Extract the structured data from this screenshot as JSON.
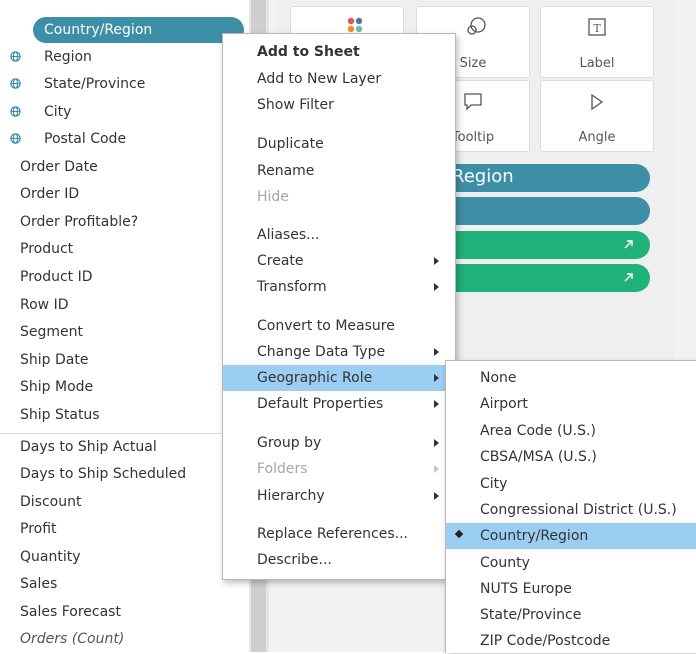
{
  "data_pane": {
    "geo_fields": [
      {
        "label": "Country/Region",
        "selected": true
      },
      {
        "label": "Region"
      },
      {
        "label": "State/Province"
      },
      {
        "label": "City"
      },
      {
        "label": "Postal Code"
      }
    ],
    "dimensions": [
      "Order Date",
      "Order ID",
      "Order Profitable?",
      "Product",
      "Product ID",
      "Row ID",
      "Segment",
      "Ship Date",
      "Ship Mode",
      "Ship Status"
    ],
    "measures": [
      "Days to Ship Actual",
      "Days to Ship Scheduled",
      "Discount",
      "Profit",
      "Quantity",
      "Sales",
      "Sales Forecast"
    ],
    "count_field": "Orders (Count)"
  },
  "marks_card": {
    "buttons": [
      {
        "label": "Size",
        "icon": "size-icon"
      },
      {
        "label": "Label",
        "icon": "label-icon"
      },
      {
        "label": "Tooltip",
        "icon": "tooltip-icon"
      },
      {
        "label": "Angle",
        "icon": "angle-icon"
      }
    ],
    "pills": [
      {
        "text": "Region",
        "color": "#3d8fa8"
      },
      {
        "text": "",
        "color": "#3d8fa8"
      },
      {
        "text": "",
        "color": "#1fb27a"
      },
      {
        "text": "",
        "color": "#1fb27a"
      }
    ]
  },
  "context_menu": {
    "items": [
      {
        "label": "Add to Sheet",
        "bold": true
      },
      {
        "label": "Add to New Layer"
      },
      {
        "label": "Show Filter"
      },
      {
        "label": "Duplicate"
      },
      {
        "label": "Rename"
      },
      {
        "label": "Hide",
        "disabled": true
      },
      {
        "label": "Aliases..."
      },
      {
        "label": "Create",
        "submenu": true
      },
      {
        "label": "Transform",
        "submenu": true
      },
      {
        "label": "Convert to Measure"
      },
      {
        "label": "Change Data Type",
        "submenu": true
      },
      {
        "label": "Geographic Role",
        "submenu": true,
        "highlighted": true
      },
      {
        "label": "Default Properties",
        "submenu": true
      },
      {
        "label": "Group by",
        "submenu": true
      },
      {
        "label": "Folders",
        "submenu": true,
        "disabled": true
      },
      {
        "label": "Hierarchy",
        "submenu": true
      },
      {
        "label": "Replace References..."
      },
      {
        "label": "Describe..."
      }
    ]
  },
  "geographic_role_submenu": {
    "items": [
      {
        "label": "None"
      },
      {
        "label": "Airport"
      },
      {
        "label": "Area Code (U.S.)"
      },
      {
        "label": "CBSA/MSA (U.S.)"
      },
      {
        "label": "City"
      },
      {
        "label": "Congressional District (U.S.)"
      },
      {
        "label": "Country/Region",
        "checked": true
      },
      {
        "label": "County"
      },
      {
        "label": "NUTS Europe"
      },
      {
        "label": "State/Province"
      },
      {
        "label": "ZIP Code/Postcode"
      }
    ]
  },
  "colors": {
    "dimension_pill": "#3d8fa8",
    "measure_pill": "#1fb27a",
    "menu_highlight": "#9ccdf3"
  }
}
